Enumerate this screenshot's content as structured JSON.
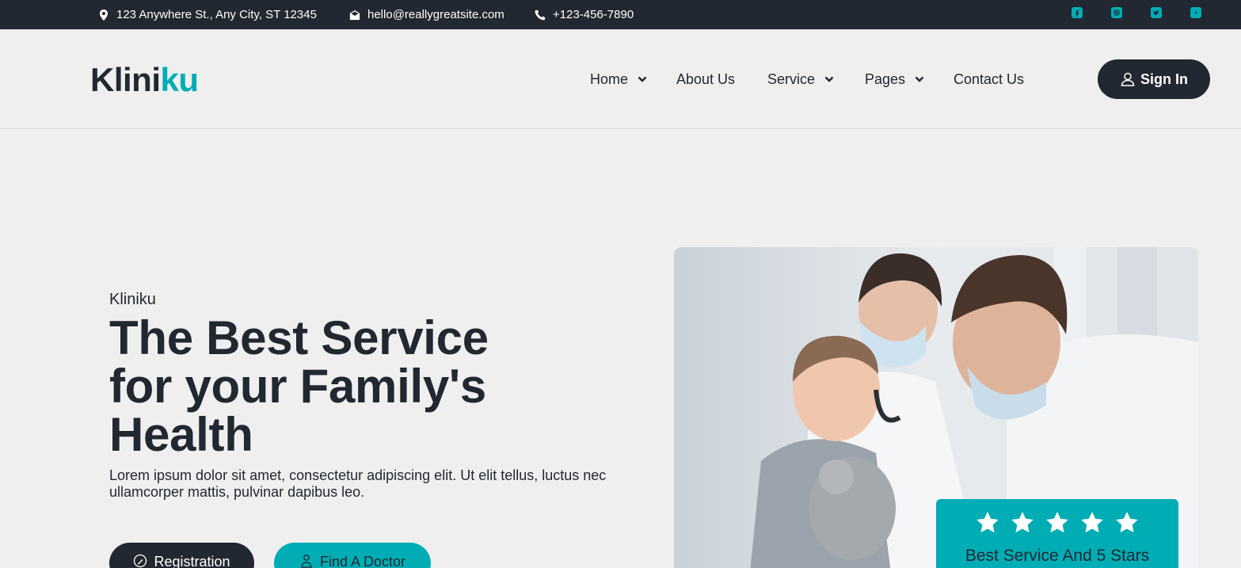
{
  "topbar": {
    "address": "123 Anywhere St., Any City, ST 12345",
    "email": "hello@reallygreatsite.com",
    "phone": "+123-456-7890",
    "social_icons": [
      "facebook-icon",
      "instagram-icon",
      "twitter-icon",
      "youtube-icon"
    ]
  },
  "brand": {
    "part1": "Klini",
    "part2": "ku"
  },
  "nav": {
    "items": [
      {
        "label": "Home",
        "has_dropdown": true
      },
      {
        "label": "About Us",
        "has_dropdown": false
      },
      {
        "label": "Service",
        "has_dropdown": true
      },
      {
        "label": "Pages",
        "has_dropdown": true
      },
      {
        "label": "Contact Us",
        "has_dropdown": false
      }
    ],
    "signin_label": "Sign In"
  },
  "hero": {
    "eyebrow": "Kliniku",
    "headline_lines": [
      "The Best Service",
      "for your Family's",
      "Health"
    ],
    "description": "Lorem ipsum dolor sit amet, consectetur adipiscing elit. Ut elit tellus, luctus nec ullamcorper mattis, pulvinar dapibus leo.",
    "btn_registration": "Registration",
    "btn_find_doctor": "Find A Doctor"
  },
  "rating": {
    "stars": 5,
    "text": "Best Service And 5 Stars"
  },
  "colors": {
    "dark": "#222831",
    "accent": "#00adb5",
    "background": "#efefef"
  }
}
